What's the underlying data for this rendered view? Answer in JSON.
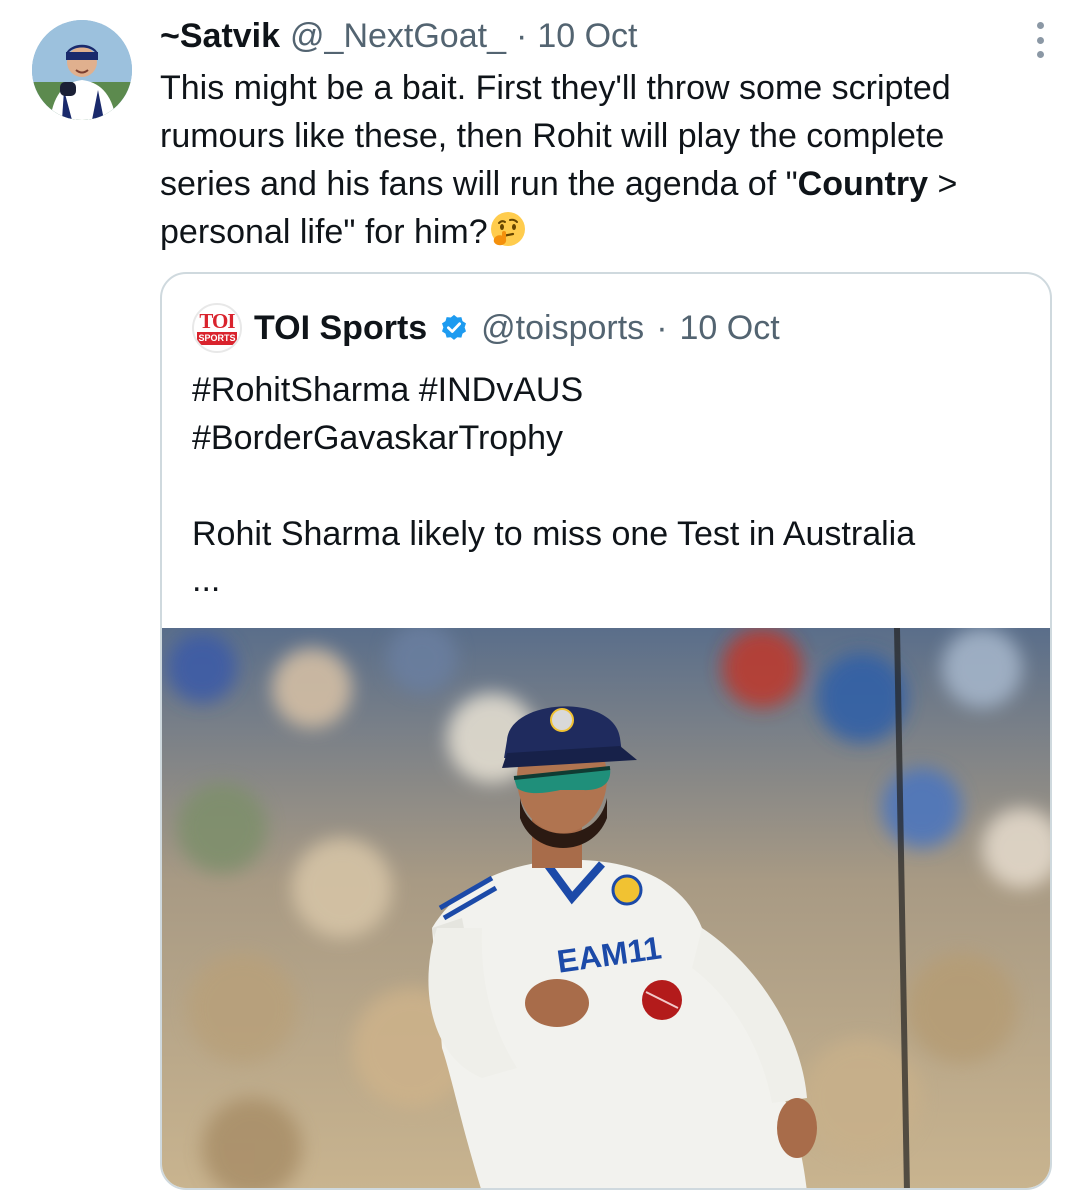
{
  "tweet": {
    "display_name": "~Satvik",
    "handle": "@_NextGoat_",
    "separator": "·",
    "time": "10 Oct",
    "text_part1": "This might be a bait. First they'll throw some scripted rumours like these, then Rohit will play the complete series and his fans will run the agenda of \"",
    "text_bold": "Country",
    "text_part2": " > personal life\" for him?",
    "emoji": "thinking-face",
    "more_icon": "more-vertical-icon"
  },
  "quote": {
    "display_name": "TOI Sports",
    "handle": "@toisports",
    "separator": "·",
    "time": "10 Oct",
    "logo_text": "TOI",
    "logo_subtext": "SPORTS",
    "line1": "#RohitSharma #INDvAUS",
    "line2": "#BorderGavaskarTrophy",
    "line3": "Rohit Sharma likely to miss one Test in Australia",
    "ellipsis": "...",
    "verified_color": "#1d9bf0",
    "brand_color": "#d9232d"
  },
  "media": {
    "jersey_text": "EAM11"
  }
}
